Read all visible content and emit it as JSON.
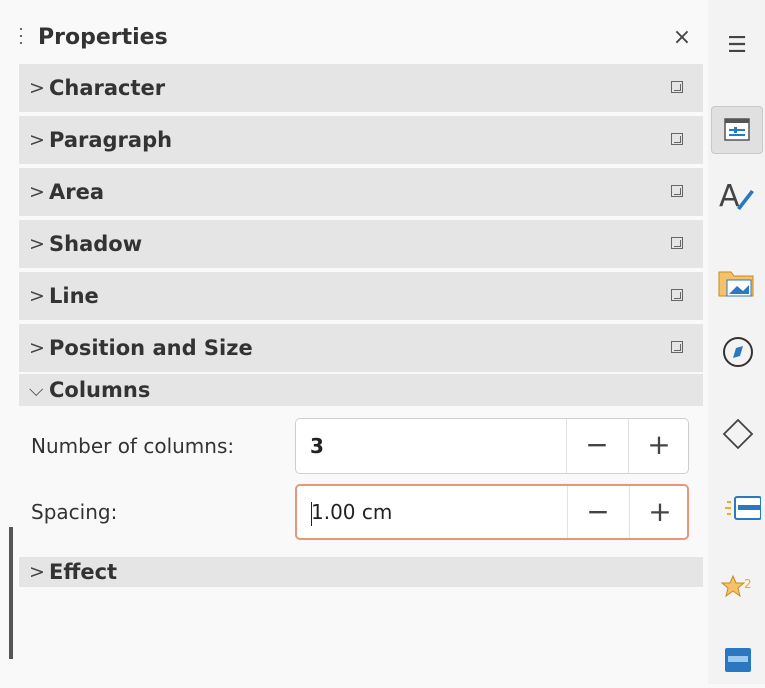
{
  "panel": {
    "title": "Properties",
    "close_glyph": "×"
  },
  "sections": [
    {
      "label": "Character",
      "chevron": ">"
    },
    {
      "label": "Paragraph",
      "chevron": ">"
    },
    {
      "label": "Area",
      "chevron": ">"
    },
    {
      "label": "Shadow",
      "chevron": ">"
    },
    {
      "label": "Line",
      "chevron": ">"
    },
    {
      "label": "Position and Size",
      "chevron": ">"
    }
  ],
  "columns": {
    "label": "Columns",
    "chevron": "⌵",
    "number_label": "Number of columns:",
    "number_value": "3",
    "spacing_label": "Spacing:",
    "spacing_value": "1.00 cm",
    "minus_glyph": "−",
    "plus_glyph": "+"
  },
  "effect": {
    "label": "Effect",
    "chevron": ">"
  },
  "tabbar": {
    "menu_glyph": "☰",
    "tabs": [
      "properties-tab-icon",
      "styles-tab-icon",
      "gallery-tab-icon",
      "navigator-tab-icon",
      "shapes-tab-icon",
      "slide-transition-tab-icon",
      "animation-tab-icon",
      "master-slides-tab-icon"
    ],
    "selected": "properties-tab-icon",
    "accent": "#2a78c2",
    "orange": "#f5a623"
  }
}
